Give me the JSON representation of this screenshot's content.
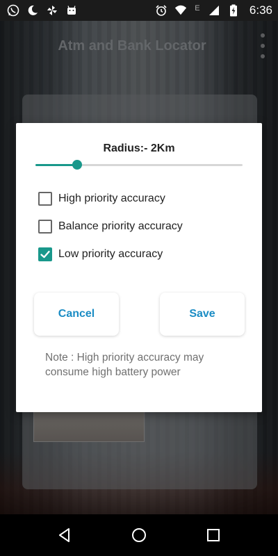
{
  "status_bar": {
    "time": "6:36",
    "left_icons": [
      "whatsapp-icon",
      "moon-icon",
      "pinwheel-icon",
      "android-icon"
    ],
    "right_icons": [
      "alarm-icon",
      "wifi-icon",
      "signal-icon",
      "battery-charging-icon"
    ],
    "network_letter": "E"
  },
  "toolbar": {
    "title": "Atm and Bank Locator"
  },
  "dialog": {
    "radius_label": "Radius:- 2Km",
    "slider": {
      "value_fraction": 0.2,
      "color": "#19988b"
    },
    "options": [
      {
        "label": "High priority accuracy",
        "checked": false
      },
      {
        "label": "Balance priority accuracy",
        "checked": false
      },
      {
        "label": "Low priority accuracy",
        "checked": true
      }
    ],
    "cancel_label": "Cancel",
    "save_label": "Save",
    "note": "Note : High priority accuracy may consume high battery power"
  },
  "colors": {
    "accent": "#19988b",
    "button_text": "#1a8cc4"
  },
  "nav_bar": {
    "icons": [
      "back-icon",
      "home-icon",
      "recents-icon"
    ]
  }
}
